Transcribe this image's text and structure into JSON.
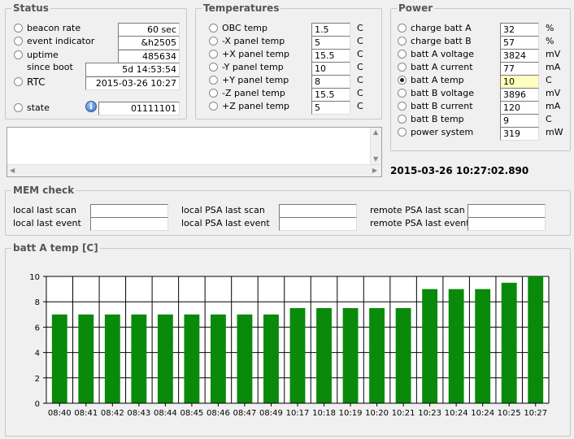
{
  "status": {
    "title": "Status",
    "beacon_rate": {
      "label": "beacon rate",
      "value": "60 sec"
    },
    "event_indicator": {
      "label": "event indicator",
      "value": "&h2505"
    },
    "uptime": {
      "label": "uptime",
      "value": "485634"
    },
    "since_boot": {
      "label": "since boot",
      "value": "5d 14:53:54"
    },
    "rtc": {
      "label": "RTC",
      "value": "2015-03-26 10:27"
    },
    "state": {
      "label": "state",
      "value": "01111101"
    }
  },
  "temperatures": {
    "title": "Temperatures",
    "items": [
      {
        "label": "OBC temp",
        "value": "1.5",
        "unit": "C"
      },
      {
        "label": "-X panel temp",
        "value": "5",
        "unit": "C"
      },
      {
        "label": "+X panel temp",
        "value": "15.5",
        "unit": "C"
      },
      {
        "label": "-Y panel temp",
        "value": "10",
        "unit": "C"
      },
      {
        "label": "+Y panel temp",
        "value": "8",
        "unit": "C"
      },
      {
        "label": "-Z panel temp",
        "value": "15.5",
        "unit": "C"
      },
      {
        "label": "+Z panel temp",
        "value": "5",
        "unit": "C"
      }
    ]
  },
  "power": {
    "title": "Power",
    "items": [
      {
        "label": "charge batt A",
        "value": "32",
        "unit": "%"
      },
      {
        "label": "charge batt B",
        "value": "57",
        "unit": "%"
      },
      {
        "label": "batt A voltage",
        "value": "3824",
        "unit": "mV"
      },
      {
        "label": "batt A current",
        "value": "77",
        "unit": "mA"
      },
      {
        "label": "batt A temp",
        "value": "10",
        "unit": "C"
      },
      {
        "label": "batt B voltage",
        "value": "3896",
        "unit": "mV"
      },
      {
        "label": "batt B current",
        "value": "120",
        "unit": "mA"
      },
      {
        "label": "batt B temp",
        "value": "9",
        "unit": "C"
      },
      {
        "label": "power system",
        "value": "319",
        "unit": "mW"
      }
    ],
    "selected_index": 4
  },
  "timestamp": "2015-03-26 10:27:02.890",
  "mem_check": {
    "title": "MEM check",
    "local_last_scan": "local last scan",
    "local_last_event": "local last event",
    "local_psa_last_scan": "local PSA last scan",
    "local_psa_last_event": "local PSA last event",
    "remote_psa_last_scan": "remote PSA last scan",
    "remote_psa_last_event": "remote PSA last event"
  },
  "chart_panel": {
    "title": "batt A temp [C]"
  },
  "colors": {
    "bar": "#0a8a0a",
    "grid": "#000000"
  },
  "chart_data": {
    "type": "bar",
    "categories": [
      "08:40",
      "08:41",
      "08:42",
      "08:43",
      "08:44",
      "08:45",
      "08:46",
      "08:47",
      "08:49",
      "10:17",
      "10:18",
      "10:19",
      "10:20",
      "10:21",
      "10:23",
      "10:24",
      "10:24",
      "10:25",
      "10:27"
    ],
    "values": [
      7,
      7,
      7,
      7,
      7,
      7,
      7,
      7,
      7,
      7.5,
      7.5,
      7.5,
      7.5,
      7.5,
      9,
      9,
      9,
      9.5,
      10
    ],
    "ylim": [
      0,
      10
    ],
    "yticks": [
      0,
      2,
      4,
      6,
      8,
      10
    ],
    "grid": true
  }
}
